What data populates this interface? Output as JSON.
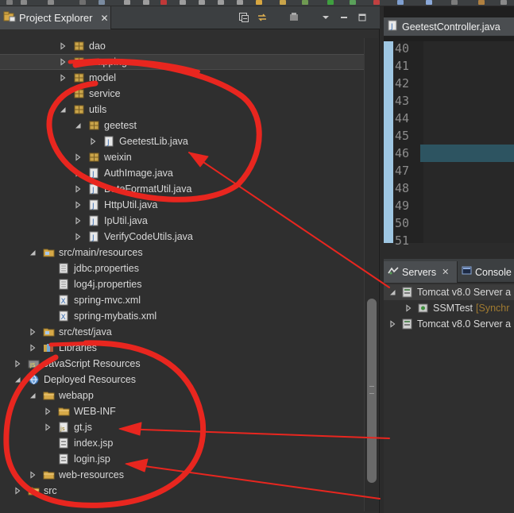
{
  "explorer": {
    "title": "Project Explorer",
    "close": "✕",
    "rows": [
      {
        "label": "dao",
        "depth": 4,
        "twisty": "closed",
        "icon": "package-icon"
      },
      {
        "label": "mapping",
        "depth": 4,
        "twisty": "closed",
        "icon": "package-icon",
        "selected": true
      },
      {
        "label": "model",
        "depth": 4,
        "twisty": "closed",
        "icon": "package-icon"
      },
      {
        "label": "service",
        "depth": 4,
        "twisty": "none",
        "icon": "package-icon"
      },
      {
        "label": "utils",
        "depth": 4,
        "twisty": "open",
        "icon": "package-icon"
      },
      {
        "label": "geetest",
        "depth": 5,
        "twisty": "open",
        "icon": "package-icon"
      },
      {
        "label": "GeetestLib.java",
        "depth": 6,
        "twisty": "closed",
        "icon": "java-file-icon"
      },
      {
        "label": "weixin",
        "depth": 5,
        "twisty": "closed",
        "icon": "package-icon"
      },
      {
        "label": "AuthImage.java",
        "depth": 5,
        "twisty": "closed",
        "icon": "java-file-icon"
      },
      {
        "label": "DateFormatUtil.java",
        "depth": 5,
        "twisty": "closed",
        "icon": "java-file-icon"
      },
      {
        "label": "HttpUtil.java",
        "depth": 5,
        "twisty": "closed",
        "icon": "java-file-icon"
      },
      {
        "label": "IpUtil.java",
        "depth": 5,
        "twisty": "closed",
        "icon": "java-file-icon"
      },
      {
        "label": "VerifyCodeUtils.java",
        "depth": 5,
        "twisty": "closed",
        "icon": "java-file-icon"
      },
      {
        "label": "src/main/resources",
        "depth": 2,
        "twisty": "open",
        "icon": "source-folder-icon"
      },
      {
        "label": "jdbc.properties",
        "depth": 3,
        "twisty": "none",
        "icon": "properties-file-icon"
      },
      {
        "label": "log4j.properties",
        "depth": 3,
        "twisty": "none",
        "icon": "properties-file-icon"
      },
      {
        "label": "spring-mvc.xml",
        "depth": 3,
        "twisty": "none",
        "icon": "xml-file-icon"
      },
      {
        "label": "spring-mybatis.xml",
        "depth": 3,
        "twisty": "none",
        "icon": "xml-file-icon"
      },
      {
        "label": "src/test/java",
        "depth": 2,
        "twisty": "closed",
        "icon": "source-folder-icon"
      },
      {
        "label": "Libraries",
        "depth": 2,
        "twisty": "closed",
        "icon": "library-icon"
      },
      {
        "label": "JavaScript Resources",
        "depth": 1,
        "twisty": "closed",
        "icon": "js-resources-icon"
      },
      {
        "label": "Deployed Resources",
        "depth": 1,
        "twisty": "open",
        "icon": "deployed-resources-icon"
      },
      {
        "label": "webapp",
        "depth": 2,
        "twisty": "open",
        "icon": "folder-icon"
      },
      {
        "label": "WEB-INF",
        "depth": 3,
        "twisty": "closed",
        "icon": "folder-icon"
      },
      {
        "label": "gt.js",
        "depth": 3,
        "twisty": "closed",
        "icon": "js-file-icon"
      },
      {
        "label": "index.jsp",
        "depth": 3,
        "twisty": "none",
        "icon": "jsp-file-icon"
      },
      {
        "label": "login.jsp",
        "depth": 3,
        "twisty": "none",
        "icon": "jsp-file-icon"
      },
      {
        "label": "web-resources",
        "depth": 2,
        "twisty": "closed",
        "icon": "folder-icon"
      },
      {
        "label": "src",
        "depth": 1,
        "twisty": "closed",
        "icon": "folder-icon"
      }
    ]
  },
  "editor": {
    "tab_title": "GeetestController.java",
    "line_numbers": [
      "40",
      "41",
      "42",
      "43",
      "44",
      "45",
      "46",
      "47",
      "48",
      "49",
      "50",
      "51"
    ]
  },
  "servers": {
    "tab_title": "Servers",
    "close": "✕",
    "console_tab": "Console",
    "rows": [
      {
        "label": "Tomcat v8.0 Server a",
        "twisty": "open",
        "selected": true
      },
      {
        "label": "SSMTest",
        "status": "[Synchr",
        "twisty": "closed",
        "child": true
      },
      {
        "label": "Tomcat v8.0 Server a",
        "twisty": "closed"
      }
    ]
  },
  "colors": {
    "annotation": "#e8261f",
    "package": "#c9a44a",
    "folder": "#d6a948",
    "java": "#6fa8d8",
    "highlight_line": "#2d5461"
  }
}
